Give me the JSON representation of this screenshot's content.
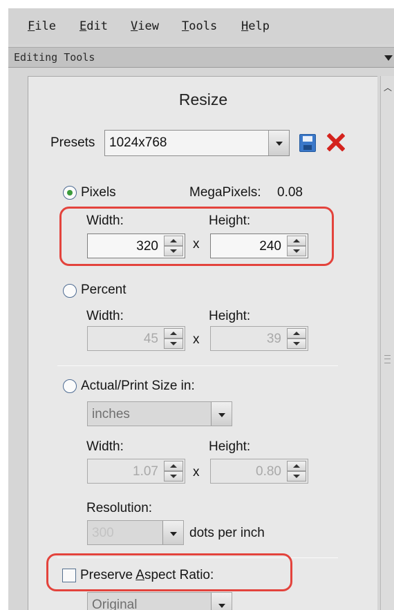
{
  "menu": [
    "File",
    "Edit",
    "View",
    "Tools",
    "Help"
  ],
  "menu_mnemonics": [
    "F",
    "E",
    "V",
    "T",
    "H"
  ],
  "menu_rest": [
    "ile",
    "dit",
    "iew",
    "ools",
    "elp"
  ],
  "tools_header": "Editing Tools",
  "panel": {
    "title": "Resize",
    "presets_label": "Presets",
    "presets_value": "1024x768",
    "pixels": {
      "label": "Pixels",
      "selected": true,
      "megapixels_label": "MegaPixels:",
      "megapixels_value": "0.08",
      "width_label": "Width:",
      "height_label": "Height:",
      "width": "320",
      "height": "240"
    },
    "times": "x",
    "percent": {
      "label": "Percent",
      "width_label": "Width:",
      "height_label": "Height:",
      "width": "45",
      "height": "39"
    },
    "actual": {
      "label": "Actual/Print Size in:",
      "unit": "inches",
      "width_label": "Width:",
      "height_label": "Height:",
      "width": "1.07",
      "height": "0.80",
      "resolution_label": "Resolution:",
      "resolution": "300",
      "resolution_unit": "dots per inch"
    },
    "preserve": {
      "label_pre": "Preserve ",
      "label_mnemonic": "A",
      "label_post": "spect Ratio:",
      "checked": false,
      "option": "Original"
    }
  },
  "colors": {
    "highlight": "#e3433c",
    "radio_dot": "#3b9b3b",
    "delete_icon": "#d4231d",
    "save_icon": "#3b78c9"
  },
  "icons": [
    "save-icon",
    "delete-icon",
    "chevron-down-icon",
    "spin-up-icon",
    "spin-down-icon",
    "scroll-up-icon"
  ]
}
